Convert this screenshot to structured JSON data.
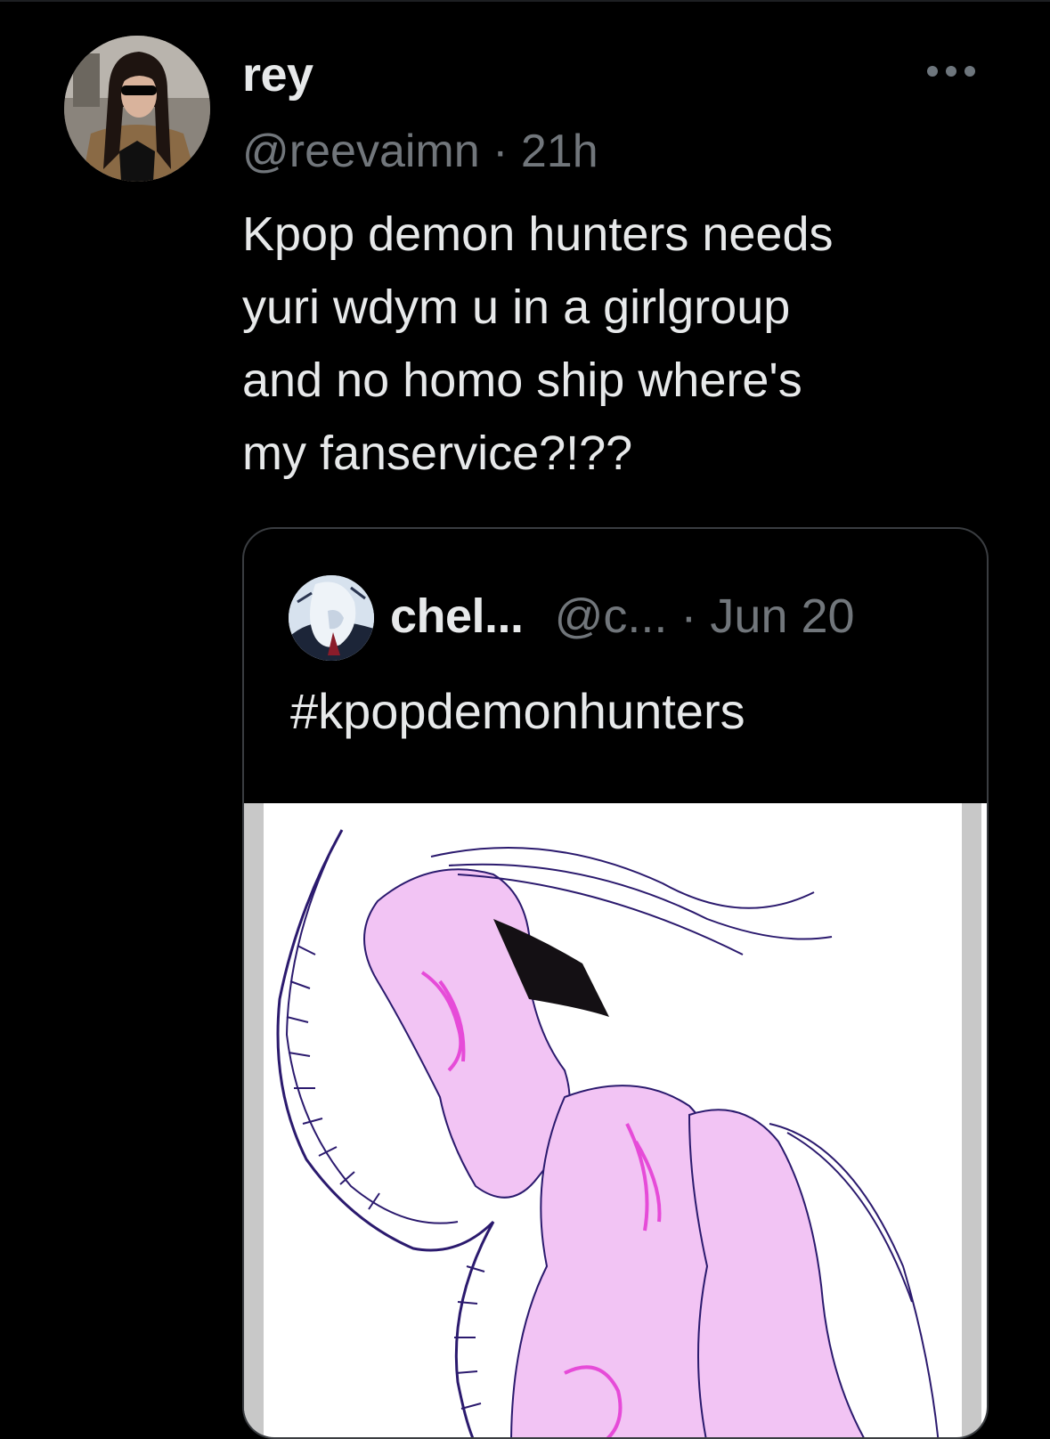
{
  "tweet": {
    "author_name": "rey",
    "handle": "@reevaimn",
    "separator": " · ",
    "time": "21h",
    "text_lines": [
      "Kpop demon hunters needs",
      "yuri wdym u in a girlgroup",
      "and no homo ship where's",
      "my fanservice?!??"
    ],
    "more_icon": "more-horizontal-icon"
  },
  "quoted_tweet": {
    "author_name": "chel...",
    "handle": "@c...",
    "separator": " · ",
    "date": "Jun 20",
    "text": "#kpopdemonhunters",
    "media": "pink line-art illustration of two long-haired characters embracing"
  },
  "colors": {
    "background": "#000000",
    "primary_text": "#e7e9ea",
    "secondary_text": "#71767b",
    "card_border": "#3a3d41",
    "art_pink": "#f2c4f4",
    "art_magenta": "#e64bd8",
    "art_ink": "#2b1a6e"
  }
}
